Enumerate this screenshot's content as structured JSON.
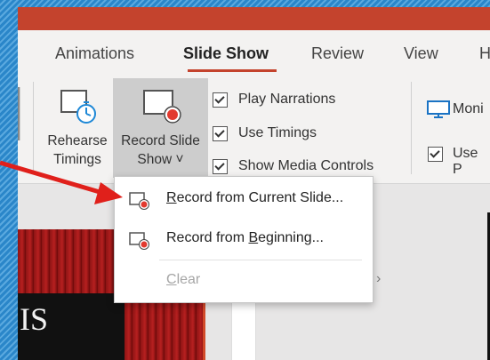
{
  "ribbon_tabs": [
    {
      "label": "Animations",
      "active": false
    },
    {
      "label": "Slide Show",
      "active": true
    },
    {
      "label": "Review",
      "active": false
    },
    {
      "label": "View",
      "active": false
    },
    {
      "label": "H",
      "active": false
    }
  ],
  "ribbon": {
    "rehearse": {
      "line1": "Rehearse",
      "line2": "Timings"
    },
    "record": {
      "line1": "Record Slide",
      "line2": "Show ˅"
    },
    "checkboxes": [
      {
        "label": "Play Narrations",
        "checked": true
      },
      {
        "label": "Use Timings",
        "checked": true
      },
      {
        "label": "Show Media Controls",
        "checked": true
      }
    ],
    "monitor_label": "Moni",
    "use_presenter_label": "Use P"
  },
  "dropdown": {
    "items": [
      {
        "pre": "",
        "accel": "R",
        "post": "ecord from Current Slide...",
        "enabled": true
      },
      {
        "pre": "Record from ",
        "accel": "B",
        "post": "eginning...",
        "enabled": true
      },
      {
        "pre": "",
        "accel": "C",
        "post": "lear",
        "enabled": false
      }
    ]
  },
  "slide_thumbnail_text": "IS",
  "colors": {
    "accent": "#c4432d",
    "arrow": "#e0201b",
    "record_dot": "#e23a2f",
    "monitor": "#1a73c4",
    "clock": "#1e88d6"
  }
}
